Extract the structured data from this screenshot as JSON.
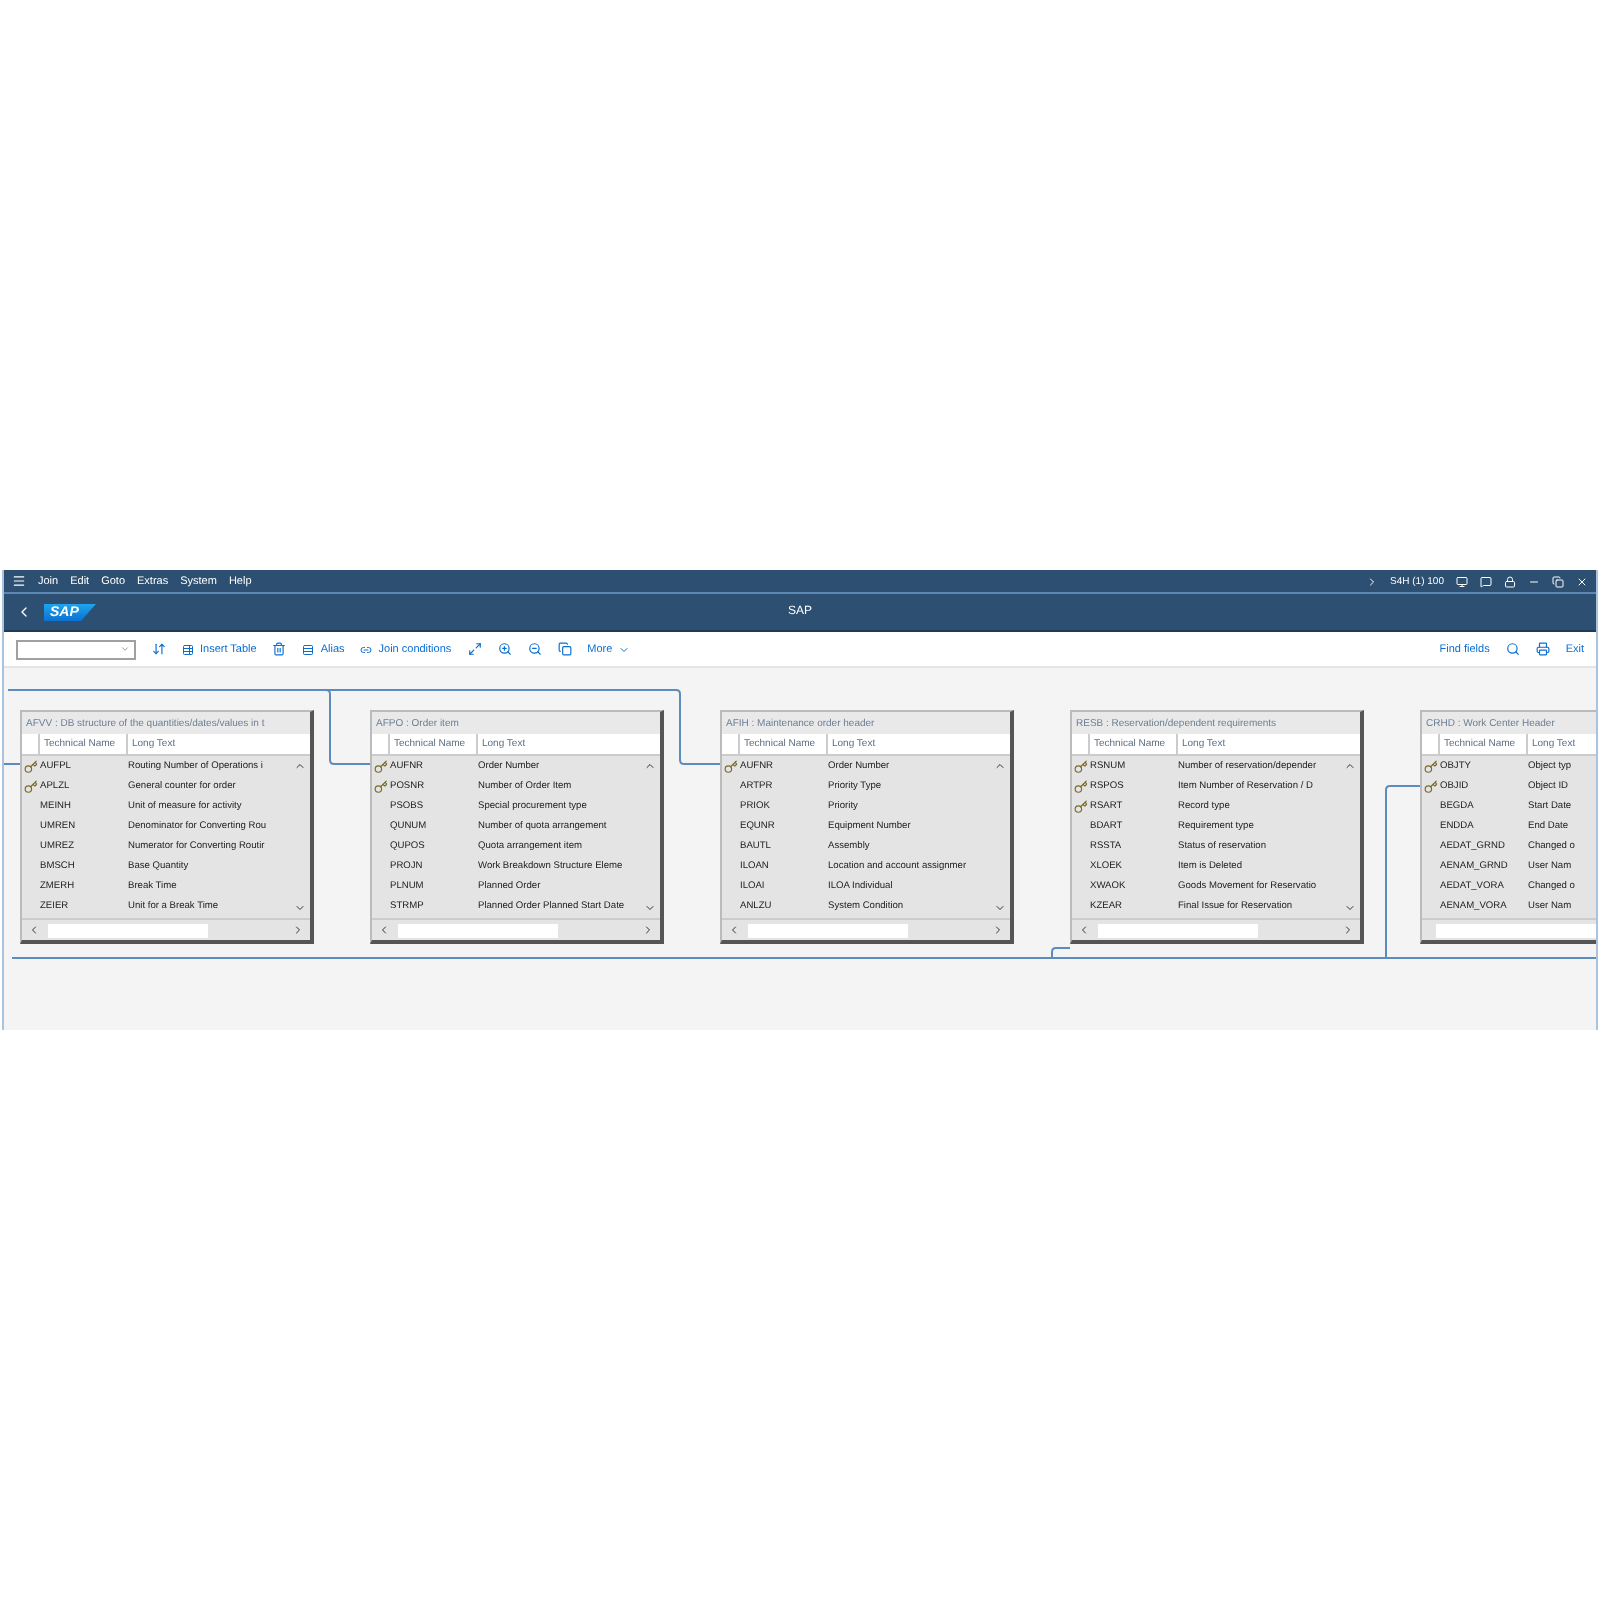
{
  "menu": [
    "Join",
    "Edit",
    "Goto",
    "Extras",
    "System",
    "Help"
  ],
  "system": "S4H (1) 100",
  "logo": "SAP",
  "title": "SAP",
  "toolbar": {
    "insert_table": "Insert Table",
    "alias": "Alias",
    "join_conditions": "Join conditions",
    "more": "More",
    "find_fields": "Find fields",
    "exit": "Exit"
  },
  "tables": [
    {
      "title": "AFVV : DB structure of the quantities/dates/values in t",
      "columns": [
        "Technical Name",
        "Long Text"
      ],
      "rows": [
        {
          "technical_name": "AUFPL",
          "long_text": "Routing Number of Operations i",
          "key": true
        },
        {
          "technical_name": "APLZL",
          "long_text": "General counter for order",
          "key": true
        },
        {
          "technical_name": "MEINH",
          "long_text": "Unit of measure for activity",
          "key": false
        },
        {
          "technical_name": "UMREN",
          "long_text": "Denominator for Converting Rou",
          "key": false
        },
        {
          "technical_name": "UMREZ",
          "long_text": "Numerator for Converting Routir",
          "key": false
        },
        {
          "technical_name": "BMSCH",
          "long_text": "Base Quantity",
          "key": false
        },
        {
          "technical_name": "ZMERH",
          "long_text": "Break Time",
          "key": false
        },
        {
          "technical_name": "ZEIER",
          "long_text": "Unit for a Break Time",
          "key": false
        }
      ]
    },
    {
      "title": "AFPO : Order item",
      "columns": [
        "Technical Name",
        "Long Text"
      ],
      "rows": [
        {
          "technical_name": "AUFNR",
          "long_text": "Order Number",
          "key": true
        },
        {
          "technical_name": "POSNR",
          "long_text": "Number of Order Item",
          "key": true
        },
        {
          "technical_name": "PSOBS",
          "long_text": "Special procurement type",
          "key": false
        },
        {
          "technical_name": "QUNUM",
          "long_text": "Number of quota arrangement",
          "key": false
        },
        {
          "technical_name": "QUPOS",
          "long_text": "Quota arrangement item",
          "key": false
        },
        {
          "technical_name": "PROJN",
          "long_text": "Work Breakdown Structure Eleme",
          "key": false
        },
        {
          "technical_name": "PLNUM",
          "long_text": "Planned Order",
          "key": false
        },
        {
          "technical_name": "STRMP",
          "long_text": "Planned Order Planned Start Date",
          "key": false
        }
      ]
    },
    {
      "title": "AFIH : Maintenance order header",
      "columns": [
        "Technical Name",
        "Long Text"
      ],
      "rows": [
        {
          "technical_name": "AUFNR",
          "long_text": "Order Number",
          "key": true
        },
        {
          "technical_name": "ARTPR",
          "long_text": "Priority Type",
          "key": false
        },
        {
          "technical_name": "PRIOK",
          "long_text": "Priority",
          "key": false
        },
        {
          "technical_name": "EQUNR",
          "long_text": "Equipment Number",
          "key": false
        },
        {
          "technical_name": "BAUTL",
          "long_text": "Assembly",
          "key": false
        },
        {
          "technical_name": "ILOAN",
          "long_text": "Location and account assignmer",
          "key": false
        },
        {
          "technical_name": "ILOAI",
          "long_text": "ILOA Individual",
          "key": false
        },
        {
          "technical_name": "ANLZU",
          "long_text": "System Condition",
          "key": false
        }
      ]
    },
    {
      "title": "RESB : Reservation/dependent requirements",
      "columns": [
        "Technical Name",
        "Long Text"
      ],
      "rows": [
        {
          "technical_name": "RSNUM",
          "long_text": "Number of reservation/depender",
          "key": true
        },
        {
          "technical_name": "RSPOS",
          "long_text": "Item Number of Reservation / D",
          "key": true
        },
        {
          "technical_name": "RSART",
          "long_text": "Record type",
          "key": true
        },
        {
          "technical_name": "BDART",
          "long_text": "Requirement type",
          "key": false
        },
        {
          "technical_name": "RSSTA",
          "long_text": "Status of reservation",
          "key": false
        },
        {
          "technical_name": "XLOEK",
          "long_text": "Item is Deleted",
          "key": false
        },
        {
          "technical_name": "XWAOK",
          "long_text": "Goods Movement for Reservatio",
          "key": false
        },
        {
          "technical_name": "KZEAR",
          "long_text": "Final Issue for Reservation",
          "key": false
        }
      ]
    },
    {
      "title": "CRHD : Work Center Header",
      "columns": [
        "Technical Name",
        "Long Text"
      ],
      "rows": [
        {
          "technical_name": "OBJTY",
          "long_text": "Object typ",
          "key": true
        },
        {
          "technical_name": "OBJID",
          "long_text": "Object ID",
          "key": true
        },
        {
          "technical_name": "BEGDA",
          "long_text": "Start Date",
          "key": false
        },
        {
          "technical_name": "ENDDA",
          "long_text": "End Date",
          "key": false
        },
        {
          "technical_name": "AEDAT_GRND",
          "long_text": "Changed o",
          "key": false
        },
        {
          "technical_name": "AENAM_GRND",
          "long_text": "User Nam",
          "key": false
        },
        {
          "technical_name": "AEDAT_VORA",
          "long_text": "Changed o",
          "key": false
        },
        {
          "technical_name": "AENAM_VORA",
          "long_text": "User Nam",
          "key": false
        }
      ]
    }
  ]
}
